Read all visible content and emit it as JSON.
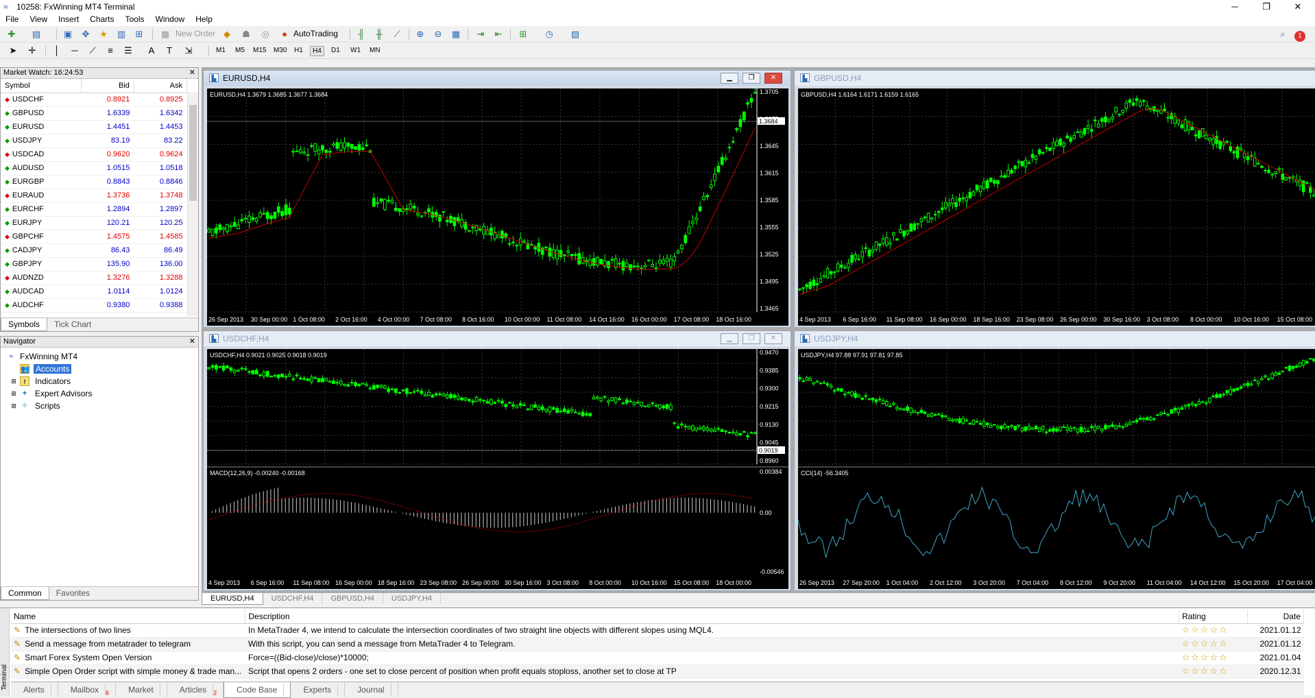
{
  "window": {
    "title": "10258: FxWinning MT4 Terminal",
    "minimize": "─",
    "maximize": "❐",
    "close": "✕"
  },
  "menu": [
    "File",
    "View",
    "Insert",
    "Charts",
    "Tools",
    "Window",
    "Help"
  ],
  "toolbar": {
    "new_order": "New Order",
    "autotrading": "AutoTrading",
    "alert_count": "1"
  },
  "timeframes": [
    "M1",
    "M5",
    "M15",
    "M30",
    "H1",
    "H4",
    "D1",
    "W1",
    "MN"
  ],
  "timeframe_selected": "H4",
  "market_watch": {
    "title": "Market Watch: 16:24:53",
    "headers": {
      "symbol": "Symbol",
      "bid": "Bid",
      "ask": "Ask"
    },
    "rows": [
      {
        "symbol": "USDCHF",
        "bid": "0.8921",
        "ask": "0.8925",
        "dir": "dn"
      },
      {
        "symbol": "GBPUSD",
        "bid": "1.6339",
        "ask": "1.6342",
        "dir": "up"
      },
      {
        "symbol": "EURUSD",
        "bid": "1.4451",
        "ask": "1.4453",
        "dir": "up"
      },
      {
        "symbol": "USDJPY",
        "bid": "83.19",
        "ask": "83.22",
        "dir": "up"
      },
      {
        "symbol": "USDCAD",
        "bid": "0.9620",
        "ask": "0.9624",
        "dir": "dn"
      },
      {
        "symbol": "AUDUSD",
        "bid": "1.0515",
        "ask": "1.0518",
        "dir": "up"
      },
      {
        "symbol": "EURGBP",
        "bid": "0.8843",
        "ask": "0.8846",
        "dir": "up"
      },
      {
        "symbol": "EURAUD",
        "bid": "1.3736",
        "ask": "1.3748",
        "dir": "dn"
      },
      {
        "symbol": "EURCHF",
        "bid": "1.2894",
        "ask": "1.2897",
        "dir": "up"
      },
      {
        "symbol": "EURJPY",
        "bid": "120.21",
        "ask": "120.25",
        "dir": "up"
      },
      {
        "symbol": "GBPCHF",
        "bid": "1.4575",
        "ask": "1.4585",
        "dir": "dn"
      },
      {
        "symbol": "CADJPY",
        "bid": "86.43",
        "ask": "86.49",
        "dir": "up"
      },
      {
        "symbol": "GBPJPY",
        "bid": "135.90",
        "ask": "136.00",
        "dir": "up"
      },
      {
        "symbol": "AUDNZD",
        "bid": "1.3276",
        "ask": "1.3288",
        "dir": "dn"
      },
      {
        "symbol": "AUDCAD",
        "bid": "1.0114",
        "ask": "1.0124",
        "dir": "up"
      },
      {
        "symbol": "AUDCHF",
        "bid": "0.9380",
        "ask": "0.9388",
        "dir": "up"
      }
    ],
    "tabs": [
      "Symbols",
      "Tick Chart"
    ]
  },
  "navigator": {
    "title": "Navigator",
    "root": "FxWinning MT4",
    "items": [
      "Accounts",
      "Indicators",
      "Expert Advisors",
      "Scripts"
    ],
    "tabs": [
      "Common",
      "Favorites"
    ]
  },
  "charts": [
    {
      "window": "EURUSD,H4",
      "info": "EURUSD,H4  1.3679 1.3685 1.3677 1.3684",
      "prices": [
        "1.3705",
        "1.3675",
        "1.3645",
        "1.3615",
        "1.3585",
        "1.3555",
        "1.3525",
        "1.3495",
        "1.3465"
      ],
      "current": "1.3684",
      "dates": [
        "26 Sep 2013",
        "30 Sep 00:00",
        "1 Oct 08:00",
        "2 Oct 16:00",
        "4 Oct 00:00",
        "7 Oct 08:00",
        "8 Oct 16:00",
        "10 Oct 00:00",
        "11 Oct 08:00",
        "14 Oct 16:00",
        "16 Oct 00:00",
        "17 Oct 08:00",
        "18 Oct 16:00"
      ]
    },
    {
      "window": "GBPUSD,H4",
      "info": "GBPUSD,H4  1.6164 1.6171 1.6159 1.6165",
      "dates": [
        "4 Sep 2013",
        "6 Sep 16:00",
        "11 Sep 08:00",
        "16 Sep 00:00",
        "18 Sep 16:00",
        "23 Sep 08:00",
        "26 Sep 00:00",
        "30 Sep 16:00",
        "3 Oct 08:00",
        "8 Oct 00:00",
        "10 Oct 16:00",
        "15 Oct 08:00"
      ]
    },
    {
      "window": "USDCHF,H4",
      "info": "USDCHF,H4  0.9021 0.9025 0.9018 0.9019",
      "prices": [
        "0.9470",
        "0.9385",
        "0.9300",
        "0.9215",
        "0.9130",
        "0.9045",
        "0.8960"
      ],
      "current": "0.9019",
      "macd_info": "MACD(12,26,9) -0.00240 -0.00168",
      "macd_prices": [
        "0.00384",
        "0.00",
        "-0.00546"
      ],
      "dates": [
        "4 Sep 2013",
        "6 Sep 16:00",
        "11 Sep 08:00",
        "16 Sep 00:00",
        "18 Sep 16:00",
        "23 Sep 08:00",
        "26 Sep 00:00",
        "30 Sep 16:00",
        "3 Oct 08:00",
        "8 Oct 00:00",
        "10 Oct 16:00",
        "15 Oct 08:00",
        "18 Oct 00:00"
      ]
    },
    {
      "window": "USDJPY,H4",
      "info": "USDJPY,H4  97.88 97.91 97.81 97.85",
      "cci_info": "CCI(14) -56.3405",
      "dates": [
        "26 Sep 2013",
        "27 Sep 20:00",
        "1 Oct 04:00",
        "2 Oct 12:00",
        "3 Oct 20:00",
        "7 Oct 04:00",
        "8 Oct 12:00",
        "9 Oct 20:00",
        "11 Oct 04:00",
        "14 Oct 12:00",
        "15 Oct 20:00",
        "17 Oct 04:00"
      ]
    }
  ],
  "chart_tabs": [
    "EURUSD,H4",
    "USDCHF,H4",
    "GBPUSD,H4",
    "USDJPY,H4"
  ],
  "terminal": {
    "side_label": "Terminal",
    "headers": {
      "name": "Name",
      "description": "Description",
      "rating": "Rating",
      "date": "Date"
    },
    "rows": [
      {
        "name": "The intersections of two lines",
        "description": "In MetaTrader 4, we intend to calculate the intersection coordinates of two straight line objects with different slopes using MQL4.",
        "stars": "☆☆☆☆☆",
        "date": "2021.01.12"
      },
      {
        "name": "Send a message from metatrader to telegram",
        "description": "With this script, you can send a message from MetaTrader 4 to Telegram.",
        "stars": "☆☆☆☆☆",
        "date": "2021.01.12"
      },
      {
        "name": "Smart Forex System Open Version",
        "description": "Force=((Bid-close)/close)*10000;",
        "stars": "☆☆☆☆☆",
        "date": "2021.01.04"
      },
      {
        "name": "Simple Open Order script with simple money & trade man...",
        "description": "Script that opens 2 orders - one set to close percent of position when profit equals stoploss, another set to close at TP",
        "stars": "☆☆☆☆☆",
        "date": "2020.12.31"
      }
    ],
    "tabs": [
      {
        "label": "Alerts",
        "badge": ""
      },
      {
        "label": "Mailbox",
        "badge": "6"
      },
      {
        "label": "Market",
        "badge": ""
      },
      {
        "label": "Articles",
        "badge": "2"
      },
      {
        "label": "Code Base",
        "badge": ""
      },
      {
        "label": "Experts",
        "badge": ""
      },
      {
        "label": "Journal",
        "badge": ""
      }
    ]
  },
  "colors": {
    "bull": "#00ff00",
    "bear": "#00ff00",
    "ma": "#c80000",
    "macd_hist": "#d0d0d0",
    "cci": "#3fa7c8",
    "grid": "#3a3a3a"
  }
}
